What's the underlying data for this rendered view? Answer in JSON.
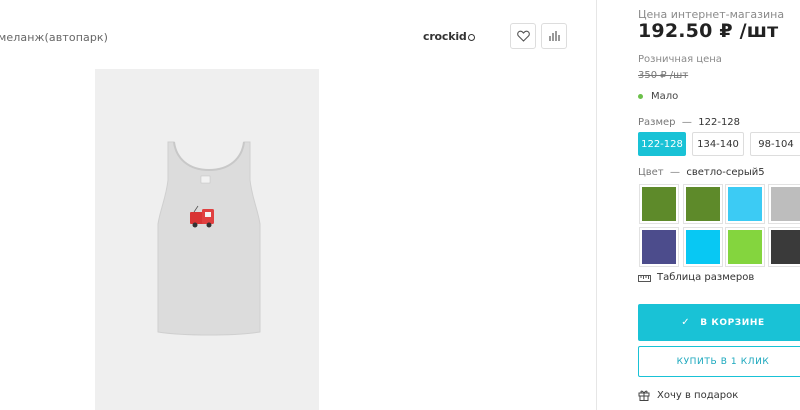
{
  "product": {
    "subtitle": "меланж(автопарк)",
    "brand": "crockid",
    "brand_icon": "crockid-logo-circle-icon",
    "favorite_icon": "heart-icon",
    "compare_icon": "bar-chart-compare-icon",
    "image_alt_icon": "tank-top-with-truck-print-icon"
  },
  "pricing": {
    "online_label": "Цена интернет-магазина",
    "online_price": "192.50 ₽ /шт",
    "retail_label": "Розничная цена",
    "retail_price": "350 ₽ /шт",
    "stock_status": "Мало",
    "stock_color": "#6cc04a"
  },
  "size": {
    "label": "Размер",
    "separator": "—",
    "selected": "122-128",
    "options": [
      "122-128",
      "134-140",
      "98-104"
    ]
  },
  "color": {
    "label": "Цвет",
    "separator": "—",
    "selected": "светло-серый5",
    "swatches": [
      "#5e8a2a",
      "#5e8a2a",
      "#3ccbf4",
      "#bdbdbd",
      "#4c4c8c",
      "#08c8f3",
      "#84d53e",
      "#3a3a3a"
    ]
  },
  "links": {
    "size_table": "Таблица размеров",
    "size_table_icon": "ruler-icon",
    "gift": "Хочу в подарок",
    "gift_icon": "gift-icon"
  },
  "actions": {
    "cart": "В КОРЗИНЕ",
    "cart_icon": "check-icon",
    "one_click": "КУПИТЬ В 1 КЛИК"
  },
  "accent_color": "#19c2d6"
}
